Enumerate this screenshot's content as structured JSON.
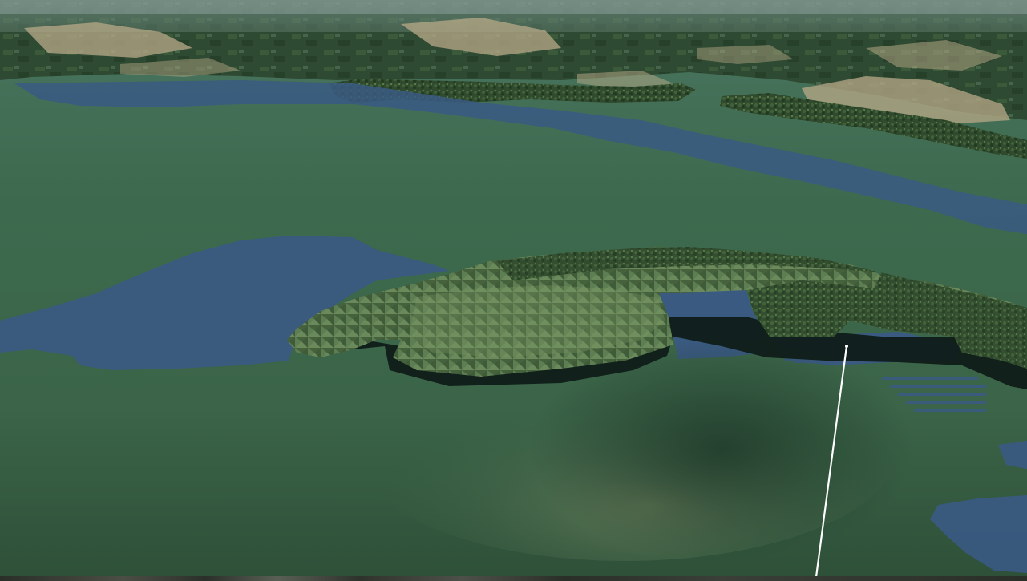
{
  "scene": {
    "type": "3d-terrain-view",
    "colors": {
      "sea_shallow": "#3f6a4c",
      "sea_deep": "#2f5540",
      "water_overlay": "#3a5a84",
      "island_top": "#4e6b45",
      "island_shadow": "#101c18",
      "distant_land": "#2f4a34",
      "urban_patches": "#b9ab8c",
      "haze": "#6f8c86",
      "trace_line": "#ffffff"
    }
  }
}
